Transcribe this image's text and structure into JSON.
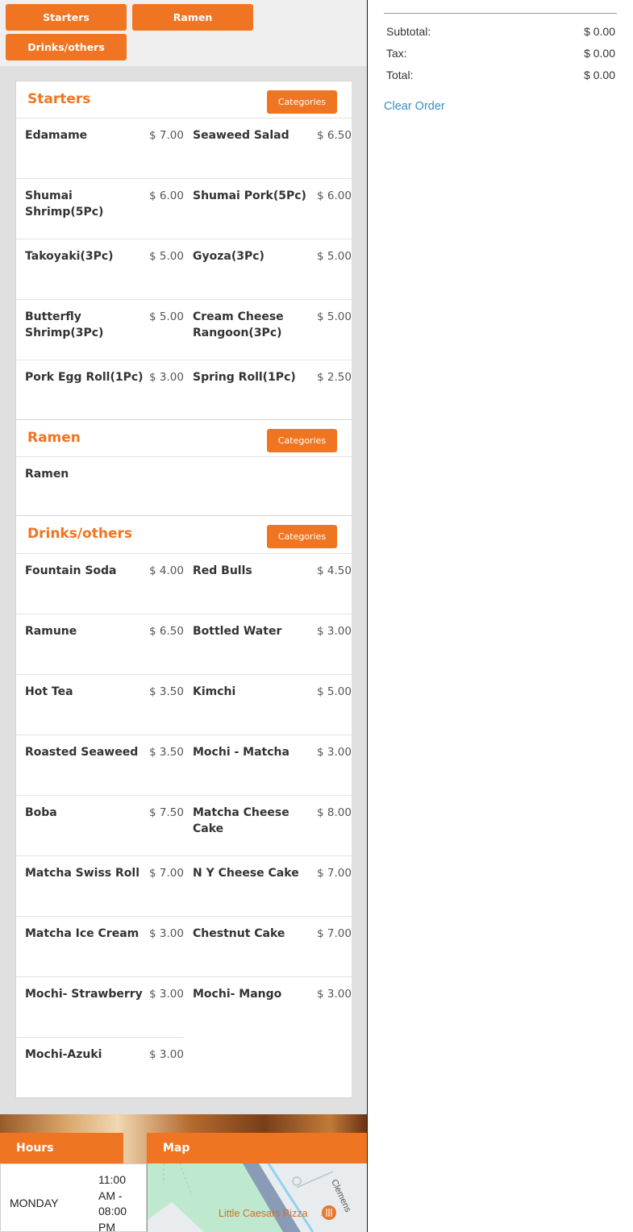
{
  "quick_nav": [
    {
      "label": "Starters"
    },
    {
      "label": "Ramen"
    },
    {
      "label": "Drinks/others"
    }
  ],
  "sections": [
    {
      "title": "Starters",
      "button": "Categories",
      "items": [
        {
          "name": "Edamame",
          "price": "$ 7.00"
        },
        {
          "name": "Seaweed Salad",
          "price": "$ 6.50"
        },
        {
          "name": "Shumai Shrimp(5Pc)",
          "price": "$ 6.00"
        },
        {
          "name": "Shumai Pork(5Pc)",
          "price": "$ 6.00"
        },
        {
          "name": "Takoyaki(3Pc)",
          "price": "$ 5.00"
        },
        {
          "name": "Gyoza(3Pc)",
          "price": "$ 5.00"
        },
        {
          "name": "Butterfly Shrimp(3Pc)",
          "price": "$ 5.00"
        },
        {
          "name": "Cream Cheese Rangoon(3Pc)",
          "price": "$ 5.00"
        },
        {
          "name": "Pork Egg Roll(1Pc)",
          "price": "$ 3.00"
        },
        {
          "name": "Spring Roll(1Pc)",
          "price": "$ 2.50"
        }
      ]
    },
    {
      "title": "Ramen",
      "button": "Categories",
      "items": [
        {
          "name": "Ramen",
          "price": ""
        }
      ]
    },
    {
      "title": "Drinks/others",
      "button": "Categories",
      "items": [
        {
          "name": "Fountain Soda",
          "price": "$ 4.00"
        },
        {
          "name": "Red Bulls",
          "price": "$ 4.50"
        },
        {
          "name": "Ramune",
          "price": "$ 6.50"
        },
        {
          "name": "Bottled Water",
          "price": "$ 3.00"
        },
        {
          "name": "Hot Tea",
          "price": "$ 3.50"
        },
        {
          "name": "Kimchi",
          "price": "$ 5.00"
        },
        {
          "name": "Roasted Seaweed",
          "price": "$ 3.50"
        },
        {
          "name": "Mochi - Matcha",
          "price": "$ 3.00"
        },
        {
          "name": "Boba",
          "price": "$ 7.50"
        },
        {
          "name": "Matcha Cheese Cake",
          "price": "$ 8.00"
        },
        {
          "name": "Matcha Swiss Roll",
          "price": "$ 7.00"
        },
        {
          "name": "N Y Cheese Cake",
          "price": "$ 7.00"
        },
        {
          "name": "Matcha Ice Cream",
          "price": "$ 3.00"
        },
        {
          "name": "Chestnut Cake",
          "price": "$ 7.00"
        },
        {
          "name": "Mochi- Strawberry",
          "price": "$ 3.00"
        },
        {
          "name": "Mochi- Mango",
          "price": "$ 3.00"
        },
        {
          "name": "Mochi-Azuki",
          "price": "$ 3.00"
        }
      ]
    }
  ],
  "footer": {
    "hours_tab": "Hours",
    "map_tab": "Map",
    "day": "MONDAY",
    "time": "11:00 AM - 08:00 PM",
    "map_place": "Little Caesars Pizza",
    "map_street": "Clemens"
  },
  "summary": {
    "subtotal_label": "Subtotal:",
    "subtotal_value": "$ 0.00",
    "tax_label": "Tax:",
    "tax_value": "$ 0.00",
    "total_label": "Total:",
    "total_value": "$ 0.00",
    "clear_label": "Clear Order"
  },
  "colors": {
    "accent": "#f07522",
    "link": "#3a8fc4"
  },
  "icons": {
    "map_pin": "restaurant-pin-icon"
  }
}
